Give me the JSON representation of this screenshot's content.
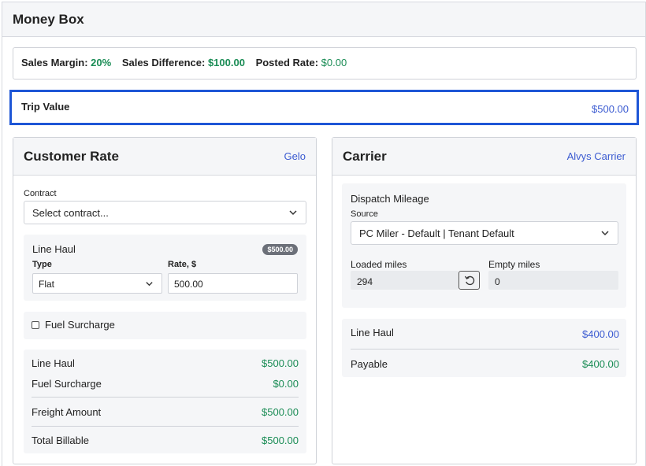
{
  "header": {
    "title": "Money Box"
  },
  "summary": {
    "sales_margin_label": "Sales Margin:",
    "sales_margin_value": "20%",
    "sales_difference_label": "Sales Difference:",
    "sales_difference_value": "$100.00",
    "posted_rate_label": "Posted Rate:",
    "posted_rate_value": "$0.00"
  },
  "trip": {
    "label": "Trip Value",
    "value": "$500.00"
  },
  "customer": {
    "title": "Customer Rate",
    "link": "Gelo",
    "contract_label": "Contract",
    "contract_value": "Select contract...",
    "line_haul": {
      "title": "Line Haul",
      "badge": "$500.00",
      "type_label": "Type",
      "type_value": "Flat",
      "rate_label": "Rate, $",
      "rate_value": "500.00"
    },
    "fuel_surcharge_label": "Fuel Surcharge",
    "totals": [
      {
        "label": "Line Haul",
        "value": "$500.00"
      },
      {
        "label": "Fuel Surcharge",
        "value": "$0.00"
      },
      {
        "label": "Freight Amount",
        "value": "$500.00"
      },
      {
        "label": "Total Billable",
        "value": "$500.00"
      }
    ]
  },
  "carrier": {
    "title": "Carrier",
    "link": "Alvys Carrier",
    "dispatch_title": "Dispatch Mileage",
    "source_label": "Source",
    "source_value": "PC Miler - Default | Tenant Default",
    "loaded_label": "Loaded miles",
    "loaded_value": "294",
    "empty_label": "Empty miles",
    "empty_value": "0",
    "totals": [
      {
        "label": "Line Haul",
        "value": "$400.00"
      },
      {
        "label": "Payable",
        "value": "$400.00"
      }
    ]
  },
  "colors": {
    "accent": "#3b5bd1",
    "positive": "#1a8c55",
    "focus_border": "#1e56d6"
  },
  "icons": {
    "select_chevron": "chevron-down-icon",
    "reset": "undo-icon"
  }
}
